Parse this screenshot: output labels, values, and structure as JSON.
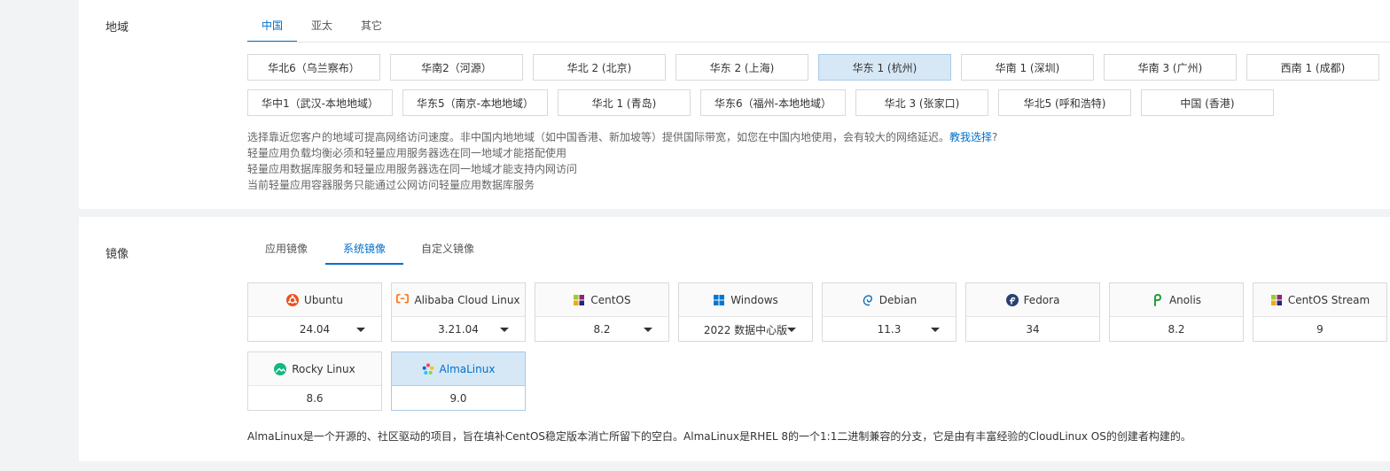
{
  "region": {
    "label": "地域",
    "tabs": [
      {
        "label": "中国",
        "active": true
      },
      {
        "label": "亚太",
        "active": false
      },
      {
        "label": "其它",
        "active": false
      }
    ],
    "rows": [
      [
        {
          "label": "华北6（乌兰察布）"
        },
        {
          "label": "华南2（河源）"
        },
        {
          "label": "华北 2 (北京)"
        },
        {
          "label": "华东 2 (上海)"
        },
        {
          "label": "华东 1 (杭州)",
          "selected": true
        },
        {
          "label": "华南 1 (深圳)"
        },
        {
          "label": "华南 3 (广州)"
        },
        {
          "label": "西南 1 (成都)"
        }
      ],
      [
        {
          "label": "华中1（武汉-本地地域）"
        },
        {
          "label": "华东5（南京-本地地域）"
        },
        {
          "label": "华北 1 (青岛)"
        },
        {
          "label": "华东6（福州-本地地域）"
        },
        {
          "label": "华北 3 (张家口)"
        },
        {
          "label": "华北5 (呼和浩特)"
        },
        {
          "label": "中国 (香港)"
        }
      ]
    ],
    "notes": {
      "line1_prefix": "选择靠近您客户的地域可提高网络访问速度。非中国内地地域（如中国香港、新加坡等）提供国际带宽，如您在中国内地使用，会有较大的网络延迟。",
      "line1_link": "教我选择",
      "line1_suffix": "?",
      "line2": "轻量应用负载均衡必须和轻量应用服务器选在同一地域才能搭配使用",
      "line3": "轻量应用数据库服务和轻量应用服务器选在同一地域才能支持内网访问",
      "line4": "当前轻量应用容器服务只能通过公网访问轻量应用数据库服务"
    }
  },
  "image": {
    "label": "镜像",
    "tabs": [
      {
        "label": "应用镜像",
        "active": false
      },
      {
        "label": "系统镜像",
        "active": true
      },
      {
        "label": "自定义镜像",
        "active": false
      }
    ],
    "os_rows": [
      [
        {
          "name": "Ubuntu",
          "version": "24.04",
          "icon": "ubuntu-icon",
          "dropdown": true
        },
        {
          "name": "Alibaba Cloud Linux",
          "version": "3.21.04",
          "icon": "alibaba-cloud-icon",
          "dropdown": true
        },
        {
          "name": "CentOS",
          "version": "8.2",
          "icon": "centos-icon",
          "dropdown": true
        },
        {
          "name": "Windows",
          "version": "2022 数据中心版",
          "icon": "windows-icon",
          "dropdown": true
        },
        {
          "name": "Debian",
          "version": "11.3",
          "icon": "debian-icon",
          "dropdown": true
        },
        {
          "name": "Fedora",
          "version": "34",
          "icon": "fedora-icon",
          "dropdown": false
        },
        {
          "name": "Anolis",
          "version": "8.2",
          "icon": "anolis-icon",
          "dropdown": false
        },
        {
          "name": "CentOS Stream",
          "version": "9",
          "icon": "centos-icon",
          "dropdown": false
        }
      ],
      [
        {
          "name": "Rocky Linux",
          "version": "8.6",
          "icon": "rocky-linux-icon",
          "dropdown": false
        },
        {
          "name": "AlmaLinux",
          "version": "9.0",
          "icon": "almalinux-icon",
          "dropdown": false,
          "selected": true
        }
      ]
    ],
    "description": "AlmaLinux是一个开源的、社区驱动的项目，旨在填补CentOS稳定版本消亡所留下的空白。AlmaLinux是RHEL 8的一个1:1二进制兼容的分支，它是由有丰富经验的CloudLinux OS的创建者构建的。"
  },
  "colors": {
    "accent": "#0070cc",
    "selected_bg": "#d6e7f6",
    "ubuntu": "#e95420",
    "alibaba": "#ff6a00",
    "windows": "#0078d4",
    "debian": "#0a6ebd",
    "fedora": "#294172",
    "anolis": "#2a9d3c",
    "rocky": "#10b981"
  }
}
